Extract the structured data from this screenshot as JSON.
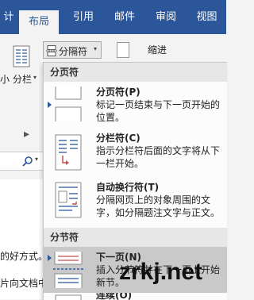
{
  "tabs": [
    "计",
    "布局",
    "引用",
    "邮件",
    "审阅",
    "视图"
  ],
  "ribbon": {
    "left_label_1": "小",
    "columns_label": "分栏",
    "breaks_label": "分隔符",
    "indent_label": "缩进"
  },
  "left_pane": {
    "arrow": "▶",
    "search_icon": "search-icon",
    "doc_line_1": "的好方式。",
    "doc_line_2": "片向文档中"
  },
  "menu": {
    "page_breaks_header": "分页符",
    "section_breaks_header": "分节符",
    "items": [
      {
        "title": "分页符(P)",
        "desc": "标记一页结束与下一页开始的位置。",
        "icon": "page-break-icon"
      },
      {
        "title": "分栏符(C)",
        "desc": "指示分栏符后面的文字将从下一栏开始。",
        "icon": "column-break-icon"
      },
      {
        "title": "自动换行符(T)",
        "desc": "分隔网页上的对象周围的文字，如分隔题注文字与正文。",
        "icon": "text-wrapping-icon"
      },
      {
        "title": "下一页(N)",
        "desc": "插入分节符并在下一页上开始新节。",
        "icon": "next-page-icon"
      },
      {
        "title": "连续(O)",
        "desc": "",
        "icon": "continuous-icon"
      }
    ]
  },
  "watermark": "zrkj.net",
  "colors": {
    "accent": "#2b579a",
    "menu_bg": "#fcfcfc",
    "header_bg": "#e7e7e7",
    "hover_bg": "#c9c9c9"
  }
}
